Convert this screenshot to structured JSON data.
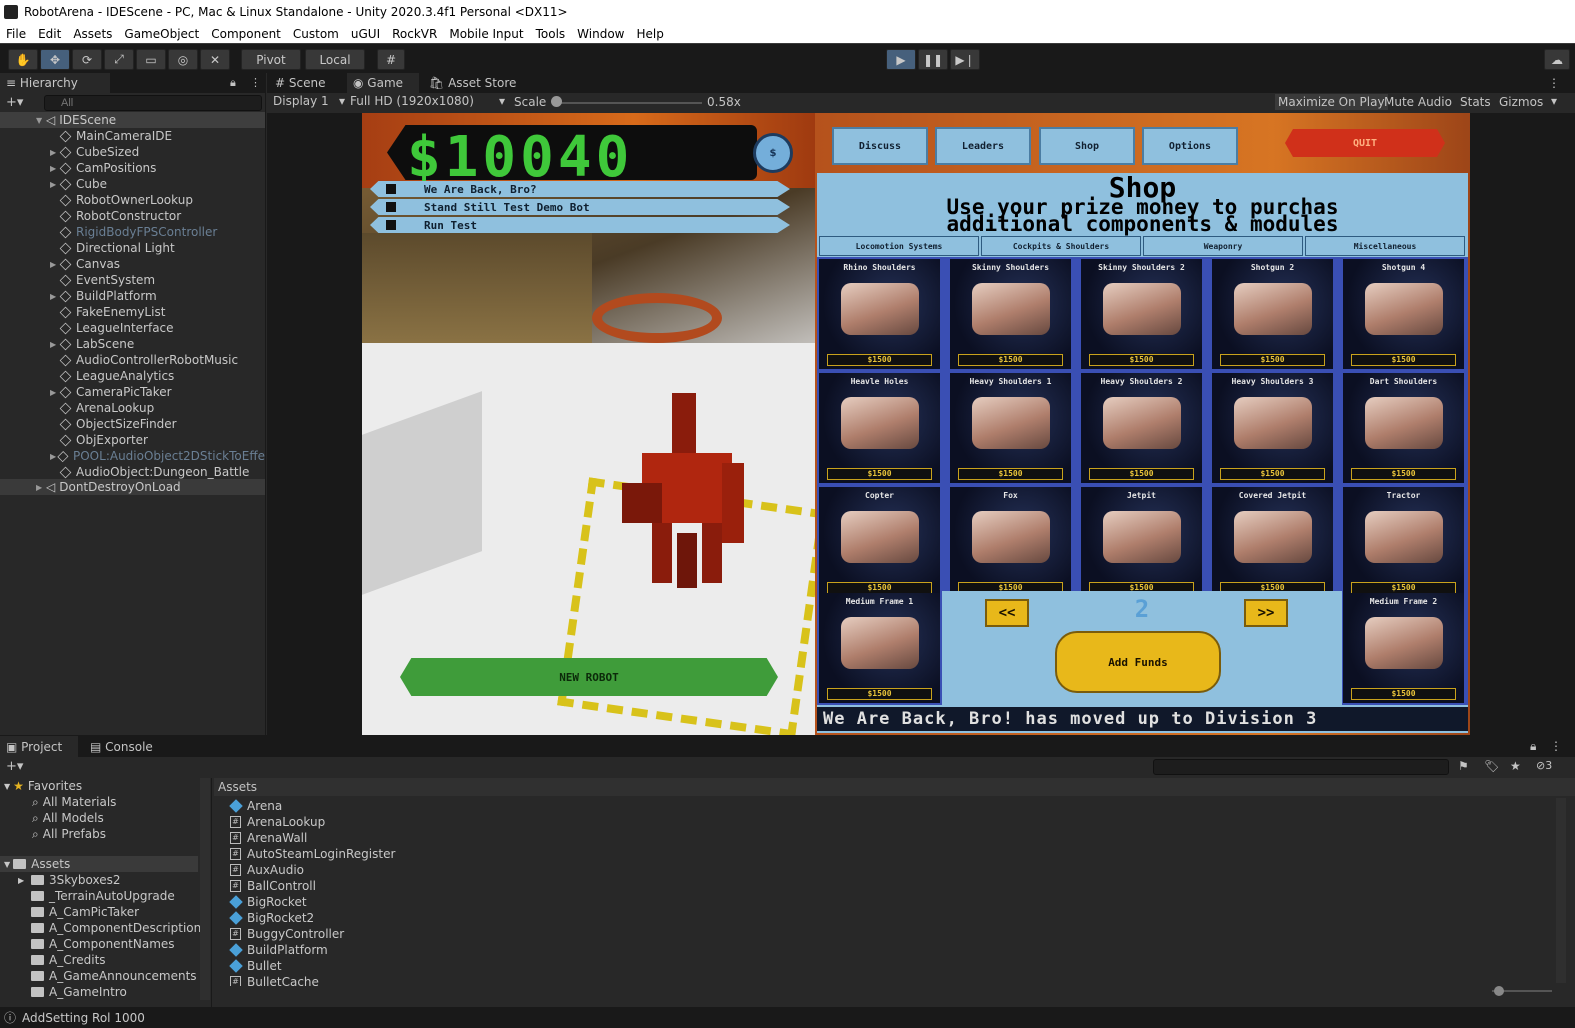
{
  "window": {
    "title": "RobotArena - IDEScene - PC, Mac & Linux Standalone - Unity 2020.3.4f1 Personal <DX11>"
  },
  "menu": [
    "File",
    "Edit",
    "Assets",
    "GameObject",
    "Component",
    "Custom",
    "uGUI",
    "RockVR",
    "Mobile Input",
    "Tools",
    "Window",
    "Help"
  ],
  "toolbar": {
    "pivot": "Pivot",
    "local": "Local"
  },
  "hierarchy": {
    "tab": "Hierarchy",
    "search_placeholder": "All",
    "scene": "IDEScene",
    "items": [
      {
        "label": "MainCameraIDE",
        "arrow": false,
        "dim": false
      },
      {
        "label": "CubeSized",
        "arrow": true,
        "dim": false
      },
      {
        "label": "CamPositions",
        "arrow": true,
        "dim": false
      },
      {
        "label": "Cube",
        "arrow": true,
        "dim": false
      },
      {
        "label": "RobotOwnerLookup",
        "arrow": false,
        "dim": false
      },
      {
        "label": "RobotConstructor",
        "arrow": false,
        "dim": false
      },
      {
        "label": "RigidBodyFPSController",
        "arrow": false,
        "dim": true
      },
      {
        "label": "Directional Light",
        "arrow": false,
        "dim": false
      },
      {
        "label": "Canvas",
        "arrow": true,
        "dim": false
      },
      {
        "label": "EventSystem",
        "arrow": false,
        "dim": false
      },
      {
        "label": "BuildPlatform",
        "arrow": true,
        "dim": false
      },
      {
        "label": "FakeEnemyList",
        "arrow": false,
        "dim": false
      },
      {
        "label": "LeagueInterface",
        "arrow": false,
        "dim": false
      },
      {
        "label": "LabScene",
        "arrow": true,
        "dim": false
      },
      {
        "label": "AudioControllerRobotMusic",
        "arrow": false,
        "dim": false
      },
      {
        "label": "LeagueAnalytics",
        "arrow": false,
        "dim": false
      },
      {
        "label": "CameraPicTaker",
        "arrow": true,
        "dim": false
      },
      {
        "label": "ArenaLookup",
        "arrow": false,
        "dim": false
      },
      {
        "label": "ObjectSizeFinder",
        "arrow": false,
        "dim": false
      },
      {
        "label": "ObjExporter",
        "arrow": false,
        "dim": false
      },
      {
        "label": "POOL:AudioObject2DStickToEffe",
        "arrow": true,
        "dim": true
      },
      {
        "label": "AudioObject:Dungeon_Battle",
        "arrow": false,
        "dim": false
      }
    ],
    "dontdestroy": "DontDestroyOnLoad"
  },
  "gameview": {
    "tabs": [
      "Scene",
      "Game",
      "Asset Store"
    ],
    "display": "Display 1",
    "resolution": "Full HD (1920x1080)",
    "scale_label": "Scale",
    "scale_value": "0.58x",
    "right_buttons": [
      "Maximize On Play",
      "Mute Audio",
      "Stats",
      "Gizmos"
    ]
  },
  "game": {
    "money": "$10040",
    "dollar_button": "$",
    "robots": [
      "We Are Back, Bro?",
      "Stand Still Test Demo Bot",
      "Run Test"
    ],
    "new_robot": "NEW ROBOT",
    "nav": [
      "Discuss",
      "Leaders",
      "Shop",
      "Options"
    ],
    "quit": "QUIT",
    "shop_title": "Shop",
    "shop_subtitle_1": "Use your prize money to purchas",
    "shop_subtitle_2": "additional components & modules",
    "categories": [
      "Locomotion Systems",
      "Cockpits & Shoulders",
      "Weaponry",
      "Miscellaneous"
    ],
    "items": [
      {
        "name": "Rhino Shoulders",
        "price": "$1500"
      },
      {
        "name": "Skinny Shoulders",
        "price": "$1500"
      },
      {
        "name": "Skinny Shoulders 2",
        "price": "$1500"
      },
      {
        "name": "Shotgun 2",
        "price": "$1500"
      },
      {
        "name": "Shotgun 4",
        "price": "$1500"
      },
      {
        "name": "Heavle Holes",
        "price": "$1500"
      },
      {
        "name": "Heavy Shoulders 1",
        "price": "$1500"
      },
      {
        "name": "Heavy Shoulders 2",
        "price": "$1500"
      },
      {
        "name": "Heavy Shoulders 3",
        "price": "$1500"
      },
      {
        "name": "Dart Shoulders",
        "price": "$1500"
      },
      {
        "name": "Copter",
        "price": "$1500"
      },
      {
        "name": "Fox",
        "price": "$1500"
      },
      {
        "name": "Jetpit",
        "price": "$1500"
      },
      {
        "name": "Covered Jetpit",
        "price": "$1500"
      },
      {
        "name": "Tractor",
        "price": "$1500"
      },
      {
        "name": "Medium Frame 1",
        "price": "$1500"
      },
      {
        "name": "Medium Frame 2",
        "price": "$1500"
      }
    ],
    "prev": "<<",
    "next": ">>",
    "page": "2",
    "add_funds": "Add Funds",
    "ticker": "We Are Back, Bro! has moved up to Division 3"
  },
  "project": {
    "tabs": [
      "Project",
      "Console"
    ],
    "favorites_label": "Favorites",
    "favorites": [
      "All Materials",
      "All Models",
      "All Prefabs"
    ],
    "assets_label": "Assets",
    "folders": [
      "3Skyboxes2",
      "_TerrainAutoUpgrade",
      "A_CamPicTaker",
      "A_ComponentDescriptions",
      "A_ComponentNames",
      "A_Credits",
      "A_GameAnnouncements",
      "A_GameIntro"
    ],
    "breadcrumb": "Assets",
    "files": [
      {
        "label": "Arena",
        "kind": "prefab"
      },
      {
        "label": "ArenaLookup",
        "kind": "script"
      },
      {
        "label": "ArenaWall",
        "kind": "script"
      },
      {
        "label": "AutoSteamLoginRegister",
        "kind": "script"
      },
      {
        "label": "AuxAudio",
        "kind": "script"
      },
      {
        "label": "BallControll",
        "kind": "script"
      },
      {
        "label": "BigRocket",
        "kind": "prefab"
      },
      {
        "label": "BigRocket2",
        "kind": "prefab"
      },
      {
        "label": "BuggyController",
        "kind": "script"
      },
      {
        "label": "BuildPlatform",
        "kind": "prefab"
      },
      {
        "label": "Bullet",
        "kind": "prefab"
      },
      {
        "label": "BulletCache",
        "kind": "script"
      }
    ],
    "hidden_count": "3"
  },
  "status": "AddSetting Rol 1000"
}
